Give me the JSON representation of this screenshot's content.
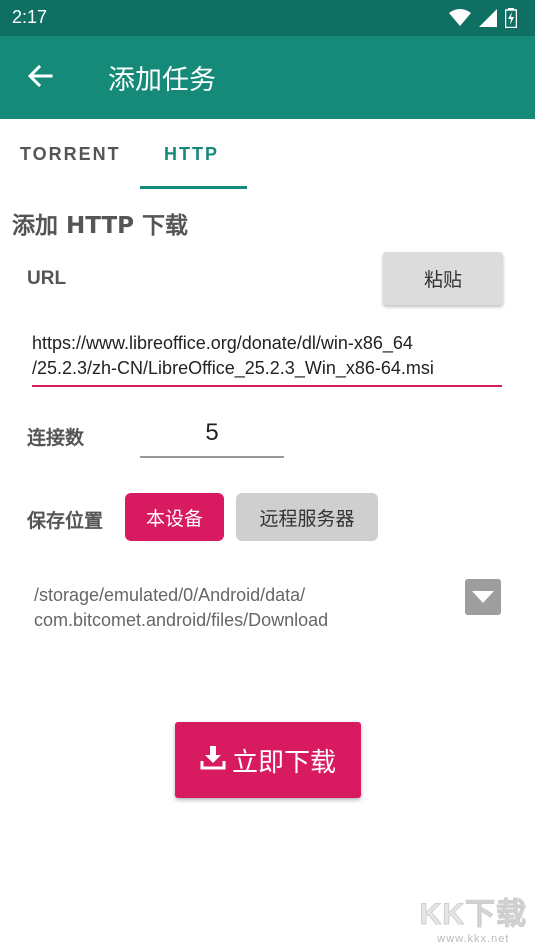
{
  "status_bar": {
    "time": "2:17",
    "icons": [
      "wifi-icon",
      "signal-icon",
      "battery-icon"
    ]
  },
  "app_bar": {
    "title": "添加任务",
    "back_icon": "arrow-left-icon",
    "color": "#158a79"
  },
  "tabs": [
    {
      "label": "TORRENT",
      "selected": false
    },
    {
      "label": "HTTP",
      "selected": true
    }
  ],
  "form": {
    "section_title": "添加 HTTP 下载",
    "url_label": "URL",
    "paste_label": "粘贴",
    "url_line1": "https://www.libreoffice.org/donate/dl/win-x86_64",
    "url_line2": "/25.2.3/zh-CN/LibreOffice_25.2.3_Win_x86-64.msi",
    "connections_label": "连接数",
    "connections_value": "5",
    "save_location_label": "保存位置",
    "device_button": "本设备",
    "remote_button": "远程服务器",
    "path_line1": "/storage/emulated/0/Android/data/",
    "path_line2": "com.bitcomet.android/files/Download",
    "download_button": "立即下载",
    "accent_color": "#d81b60"
  },
  "watermark": {
    "logo": "KK下载",
    "url": "www.kkx.net"
  }
}
